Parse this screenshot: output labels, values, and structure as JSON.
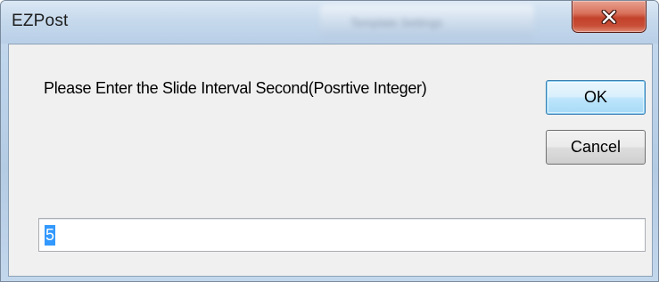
{
  "window": {
    "title": "EZPost",
    "background_title": "Template Settings"
  },
  "dialog": {
    "prompt": "Please Enter the Slide Interval Second(Posrtive Integer)",
    "ok_label": "OK",
    "cancel_label": "Cancel",
    "input_value": "5"
  },
  "icons": {
    "close": "close-icon"
  },
  "colors": {
    "close_button": "#c94e36",
    "ok_border": "#3c7fb1",
    "selection": "#3399ff",
    "client_bg": "#f0f0f0"
  }
}
